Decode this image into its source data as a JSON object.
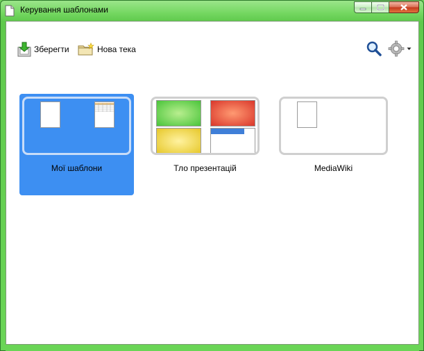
{
  "window": {
    "title": "Керування шаблонами",
    "accent": "#6ad556"
  },
  "toolbar": {
    "save_label": "Зберегти",
    "new_folder_label": "Нова тека"
  },
  "folders": [
    {
      "label": "Мої шаблони",
      "selected": true
    },
    {
      "label": "Тло презентацій",
      "selected": false
    },
    {
      "label": "MediaWiki",
      "selected": false
    }
  ],
  "colors": {
    "selection": "#3d8ff2",
    "slide_green": "#49c43a",
    "slide_red": "#d9362a",
    "slide_yellow": "#e6c728",
    "slide_blue": "#3f7fd8"
  }
}
